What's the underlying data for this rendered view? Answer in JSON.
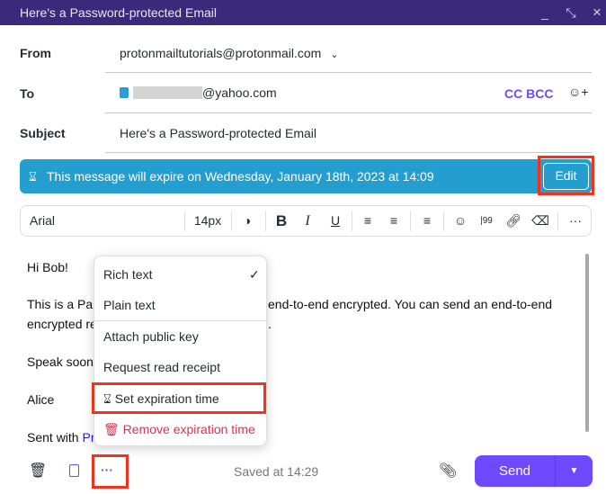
{
  "window": {
    "title": "Here's a Password-protected Email",
    "minimize": "_",
    "collapse": "⤡",
    "close": "×"
  },
  "from": {
    "label": "From",
    "value": "protonmailtutorials@protonmail.com"
  },
  "to": {
    "label": "To",
    "value": "@yahoo.com",
    "cc_bcc": "CC BCC"
  },
  "subject": {
    "label": "Subject",
    "value": "Here's a Password-protected Email"
  },
  "banner": {
    "text": "This message will expire on Wednesday, January 18th, 2023 at 14:09",
    "edit": "Edit"
  },
  "toolbar": {
    "font": "Arial",
    "size": "14px",
    "bold": "B",
    "italic": "I",
    "underline": "U",
    "more": "···"
  },
  "body": {
    "greeting": "Hi Bob!",
    "line1a": "This is a Pa",
    "line1b": "end-to-end encrypted. You can send an end-to-end",
    "line2a": "encrypted re",
    "line2b": ".",
    "sign1": "Speak soon",
    "sign2": "Alice",
    "sent_with": "Sent with ",
    "sent_link": "Pr"
  },
  "menu": {
    "items": [
      "Rich text",
      "Plain text",
      "Attach public key",
      "Request read receipt",
      "Set expiration time",
      "Remove expiration time"
    ],
    "check": "✓"
  },
  "footer": {
    "saved": "Saved at 14:29",
    "send": "Send",
    "more": "···"
  },
  "colors": {
    "accent": "#6d4aff",
    "banner": "#239ece",
    "titlebar": "#3b2a7b",
    "danger": "#dc3251"
  }
}
